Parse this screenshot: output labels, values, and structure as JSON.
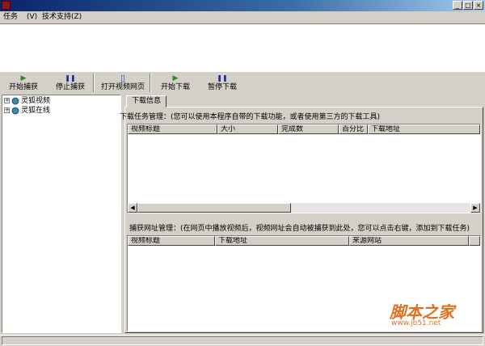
{
  "window": {
    "minimize_glyph": "_",
    "maximize_glyph": "□",
    "close_glyph": "×"
  },
  "menu": {
    "items": [
      {
        "label": "任务"
      },
      {
        "label": "(V)"
      },
      {
        "label": "技术支持(Z)"
      }
    ]
  },
  "toolbar": {
    "buttons": [
      {
        "label": "开始捕获",
        "icon": "play-icon",
        "glyph": "▶",
        "color": "#2a8a2a"
      },
      {
        "label": "停止捕获",
        "icon": "pause-icon",
        "glyph": "❚❚",
        "color": "#1a2a9a"
      },
      {
        "label": "打开视频网页",
        "icon": "page-icon",
        "glyph": "▯",
        "color": "#2050a0"
      },
      {
        "label": "开始下载",
        "icon": "play-icon",
        "glyph": "▶",
        "color": "#2a8a2a"
      },
      {
        "label": "暂停下载",
        "icon": "pause-icon",
        "glyph": "❚❚",
        "color": "#1a2a9a"
      }
    ]
  },
  "tree": {
    "items": [
      {
        "label": "灵狐视频",
        "expander": "+"
      },
      {
        "label": "灵狐在线",
        "expander": "+"
      }
    ]
  },
  "tab": {
    "label": "下载信息"
  },
  "downloads": {
    "section_label": "下载任务管理：(您可以使用本程序自带的下载功能，或者使用第三方的下载工具)",
    "columns": [
      "视频标题",
      "大小",
      "完成数",
      "百分比",
      "下载地址"
    ]
  },
  "captures": {
    "section_label": "捕获网址管理：(在网页中播放视频后，视频网址会自动被捕获到此处，您可以点击右键，添加到下载任务)",
    "columns": [
      "视频标题",
      "下载地址",
      "来源网站"
    ]
  },
  "watermark": {
    "logo_text": "脚本之家",
    "url": "www.jb51.net"
  },
  "colors": {
    "title_bar_start": "#0a246a",
    "title_bar_end": "#a6caf0",
    "panel_bg": "#d4d0c8",
    "watermark": "#e07020"
  }
}
